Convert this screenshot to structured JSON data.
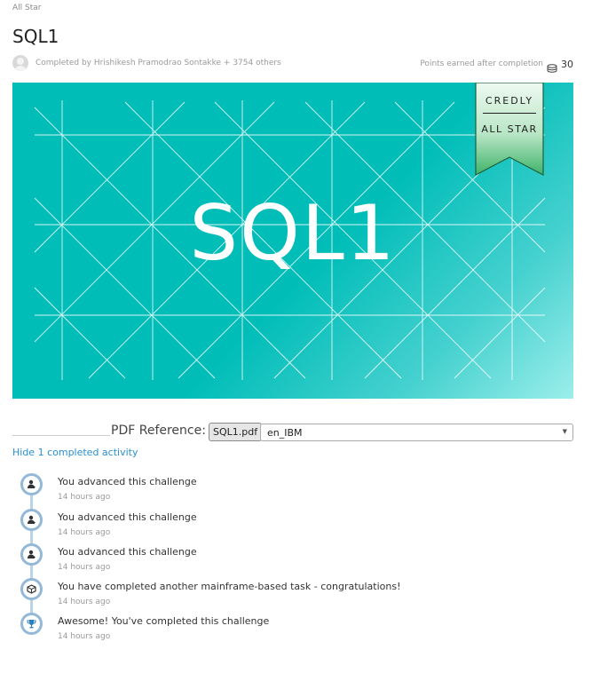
{
  "breadcrumb": "All Star",
  "title": "SQL1",
  "meta": {
    "completed_by": "Completed by Hrishikesh Pramodrao Sontakke + 3754 others",
    "points_label": "Points earned after completion",
    "points_value": "30"
  },
  "banner": {
    "title": "SQL1",
    "ribbon_top": "CREDLY",
    "ribbon_bottom": "ALL STAR",
    "colors": {
      "teal": "#00bdb8",
      "light": "#9ceeea",
      "ribbon_top": "#e4f6ea",
      "ribbon_bottom": "#3fb36a"
    }
  },
  "pdf": {
    "label": "PDF Reference:",
    "file": "SQL1.pdf",
    "language_selected": "en_IBM"
  },
  "activity": {
    "toggle_label": "Hide 1 completed activity",
    "items": [
      {
        "icon": "user-advance-icon",
        "text": "You advanced this challenge",
        "time": "14 hours ago"
      },
      {
        "icon": "user-advance-icon",
        "text": "You advanced this challenge",
        "time": "14 hours ago"
      },
      {
        "icon": "user-advance-icon",
        "text": "You advanced this challenge",
        "time": "14 hours ago"
      },
      {
        "icon": "cube-icon",
        "text": "You have completed another mainframe-based task - congratulations!",
        "time": "14 hours ago"
      },
      {
        "icon": "trophy-icon",
        "text": "Awesome! You've completed this challenge",
        "time": "14 hours ago"
      }
    ]
  }
}
